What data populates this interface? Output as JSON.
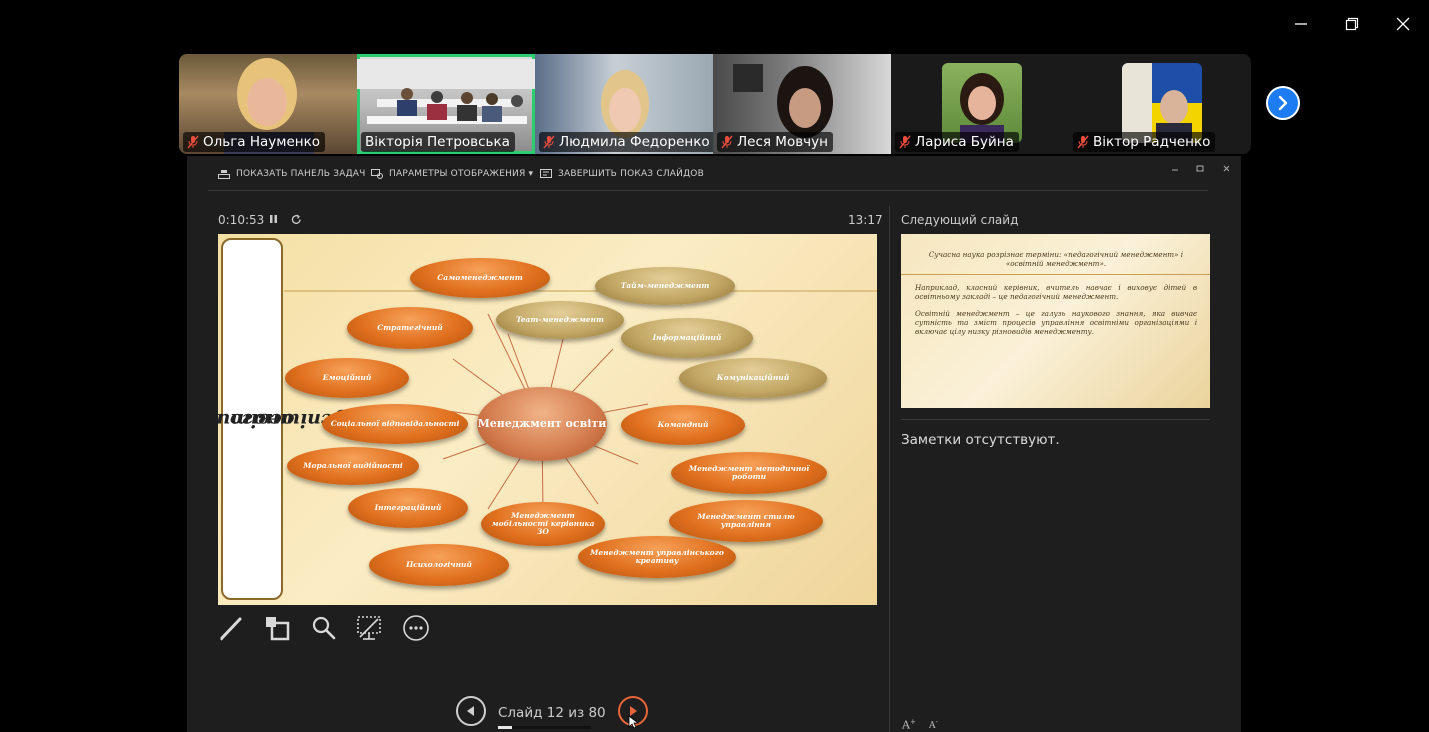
{
  "window_controls": {
    "minimize": "minimize-icon",
    "restore": "restore-icon",
    "close": "close-icon"
  },
  "participants": [
    {
      "name": "Ольга Науменко",
      "muted": true
    },
    {
      "name": "Вікторія Петровська",
      "muted": false,
      "active_speaker": true
    },
    {
      "name": "Людмила Федоренко",
      "muted": true
    },
    {
      "name": "Леся Мовчун",
      "muted": true
    },
    {
      "name": "Лариса Буйна",
      "muted": true
    },
    {
      "name": "Віктор Радченко",
      "muted": true
    }
  ],
  "presenter": {
    "toolbar": {
      "show_taskbar": "ПОКАЗАТЬ ПАНЕЛЬ ЗАДАЧ",
      "display_settings": "ПАРАМЕТРЫ ОТОБРАЖЕНИЯ ▾",
      "end_show": "ЗАВЕРШИТЬ ПОКАЗ СЛАЙДОВ"
    },
    "elapsed": "0:10:53",
    "clock": "13:17",
    "next_slide_label": "Следующий слайд",
    "notes": "Заметки отсутствуют.",
    "slide_counter": "Слайд 12 из 80",
    "progress": 0.15,
    "font_increase": "A",
    "font_decrease": "A"
  },
  "slide": {
    "title_line1": "Складові успішного менеджменту",
    "title_line2": "освіти:",
    "center": "Менеджмент освіти",
    "items": [
      "Самоменеджмент",
      "Тайм-менеджмент",
      "Стратегічний",
      "Team-менеджмент",
      "Інформаційний",
      "Емоційний",
      "Комунікаційний",
      "Соціальної відповідальності",
      "Командний",
      "Моральної видійності",
      "Менеджмент методичної роботи",
      "Інтеграційний",
      "Менеджмент мобільності керівника ЗО",
      "Менеджмент стилю управління",
      "Менеджмент управлінського креативу",
      "Психологічний"
    ]
  },
  "next_slide": {
    "p1": "Сучасна наука розрізнає терміни: «педагогічний менеджмент» і «освітній менеджмент».",
    "p2": "Наприклад, класний керівник, вчитель навчає і виховує дітей в освітньому закладі – це педагогічний менеджмент.",
    "p3": "Освітній менеджмент – це галузь наукового знання, яка вивчає сутність та зміст процесів управління освітніми організаціями і включає цілу низку різновидів менеджменту."
  },
  "colors": {
    "accent": "#1d7cf2",
    "active_outline": "#2ecc71",
    "next_arrow": "#e8643a"
  }
}
